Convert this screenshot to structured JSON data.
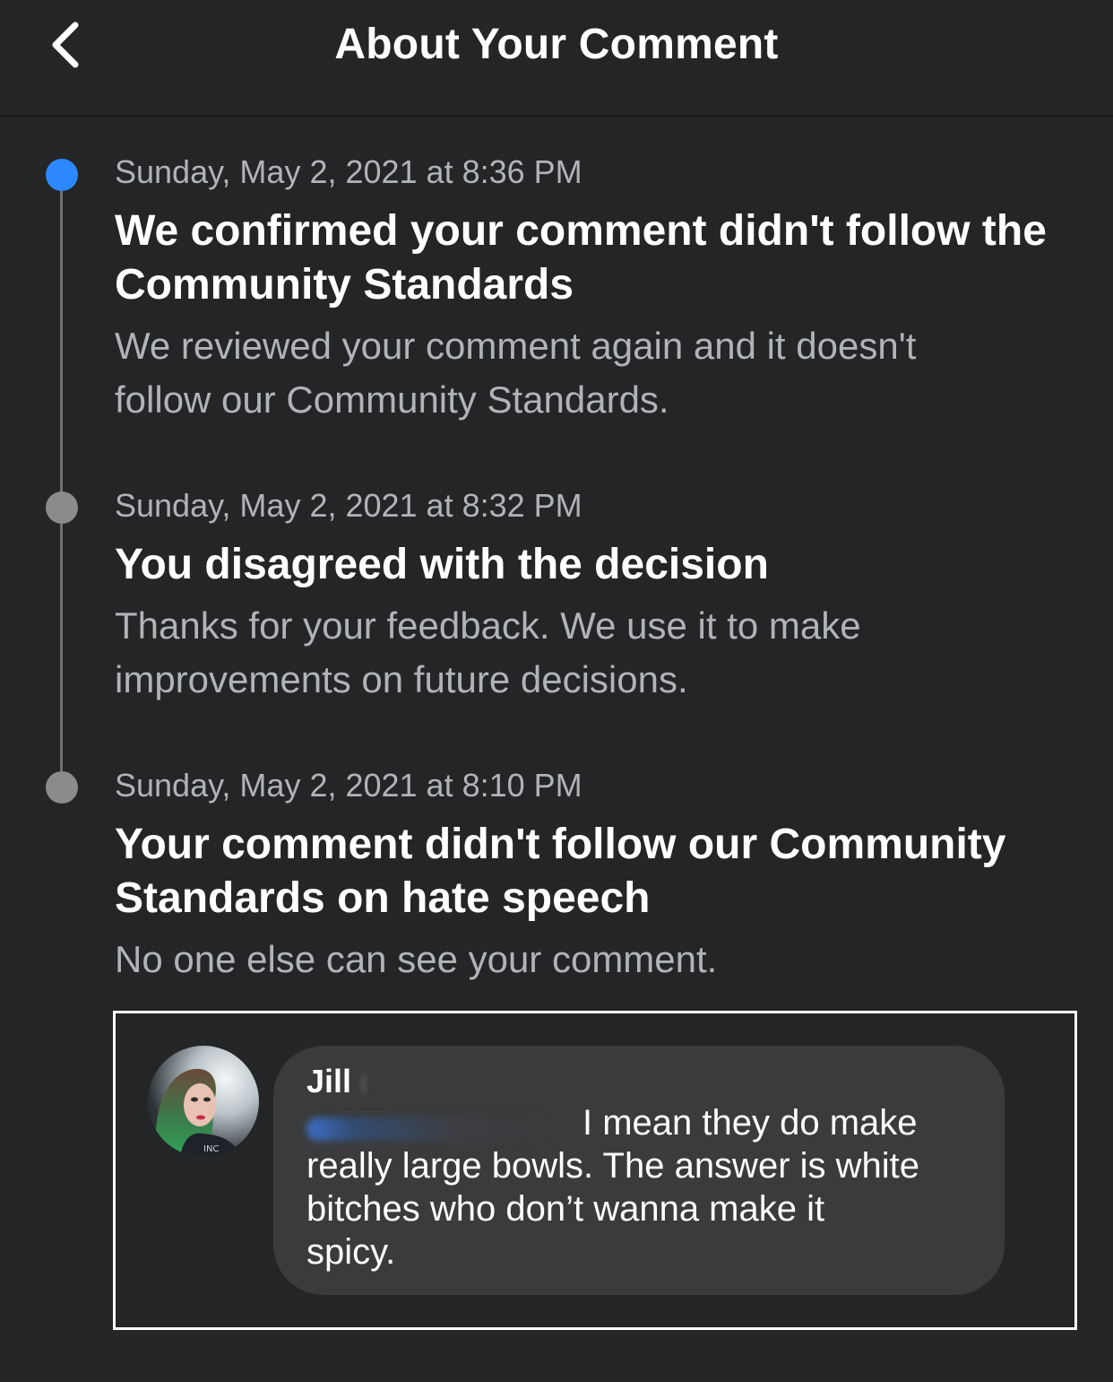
{
  "header": {
    "title": "About Your Comment",
    "back_icon": "chevron-left-icon"
  },
  "colors": {
    "background": "#242526",
    "accent_blue": "#2d88ff",
    "secondary_text": "#b0b3b8",
    "bubble": "#3a3b3c"
  },
  "timeline": {
    "events": [
      {
        "time": "Sunday, May 2, 2021 at 8:36 PM",
        "title_line1": "We confirmed your comment didn't follow the",
        "title_line2": "Community Standards",
        "desc_line1": "We reviewed your comment again and it doesn't",
        "desc_line2": "follow our Community Standards.",
        "status": "current"
      },
      {
        "time": "Sunday, May 2, 2021 at 8:32 PM",
        "title_line1": "You disagreed with the decision",
        "desc_line1": "Thanks for your feedback. We use it to make",
        "desc_line2": "improvements on future decisions.",
        "status": "past"
      },
      {
        "time": "Sunday, May 2, 2021 at 8:10 PM",
        "title_line1": "Your comment didn't follow our Community",
        "title_line2": "Standards on hate speech",
        "desc_line1": "No one else can see your comment.",
        "status": "past"
      }
    ]
  },
  "comment": {
    "author": "Jill",
    "line1": "I mean they do make",
    "line2": "really large bowls. The answer is white",
    "line3": "bitches who don’t wanna make it",
    "line4": "spicy."
  }
}
